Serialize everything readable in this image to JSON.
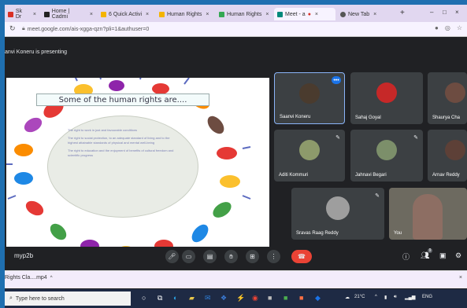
{
  "browser": {
    "tabs": [
      {
        "label": "Sk Dr",
        "fav": "#d93025"
      },
      {
        "label": "Home | Cadmi",
        "fav": "#222"
      },
      {
        "label": "6 Quick Activi",
        "fav": "#f4b400"
      },
      {
        "label": "Human Rights",
        "fav": "#f4b400"
      },
      {
        "label": "Human Rights",
        "fav": "#34a853"
      },
      {
        "label": "Meet - a",
        "fav": "#00897b",
        "active": true
      },
      {
        "label": "New Tab",
        "fav": "#555"
      }
    ],
    "new_tab": "+",
    "url": "meet.google.com/ais-xgga-qzn?pli=1&authuser=0",
    "window_controls": [
      "–",
      "□",
      "×"
    ]
  },
  "meet": {
    "presenting_text": "anvi Koneru is presenting",
    "slide": {
      "title": "Some of the human rights are....",
      "points": [
        "The right to work in just and favourable conditions",
        "The right to social protection, to an adequate standard of living and to the highest attainable standards of physical and mental well-being",
        "The right to education and the enjoyment of benefits of cultural freedom and scientific progress"
      ]
    },
    "participants": [
      {
        "name": "Saanvi Koneru",
        "speaking": true,
        "avatar": "#4a3b2e"
      },
      {
        "name": "Sahaj Goyal",
        "avatar": "#c62828"
      },
      {
        "name": "Shaurya Cha",
        "avatar": "#6d4c41"
      },
      {
        "name": "Aditi Kommuri",
        "avatar": "#8d9a6b"
      },
      {
        "name": "Jahnavi Begari",
        "avatar": "#7c8f6a"
      },
      {
        "name": "Arnav Reddy",
        "avatar": "#5d4037"
      },
      {
        "name": "Sravas Raag Reddy",
        "avatar": "#9e9e9e"
      },
      {
        "name": "You",
        "avatar": "#8d6e63"
      }
    ],
    "more_label": "•••",
    "meeting_code": "myp2b",
    "people_count": "9"
  },
  "downloads": {
    "file": "Rights Cla....mp4"
  },
  "taskbar": {
    "search_placeholder": "Type here to search",
    "temperature": "21°C",
    "lang": "ENG"
  }
}
